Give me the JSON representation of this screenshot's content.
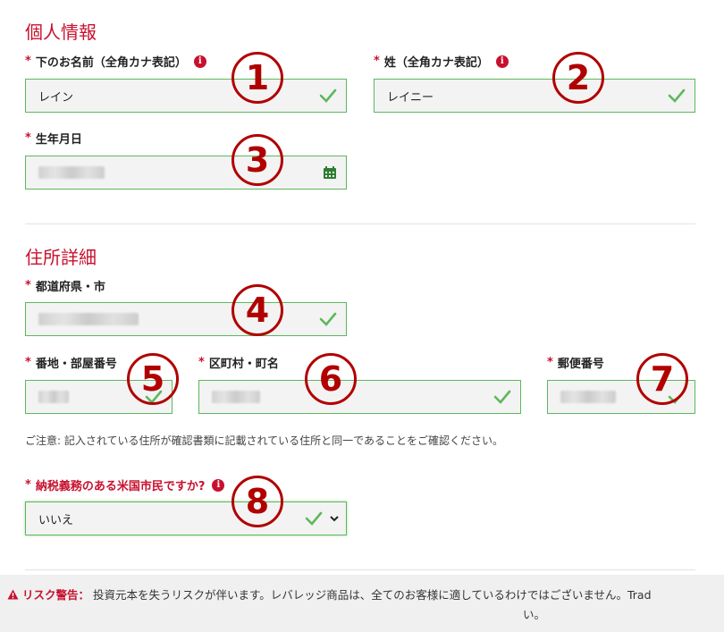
{
  "personal": {
    "section_title": "個人情報",
    "first_name_label": "下のお名前（全角カナ表記）",
    "first_name_value": "レイン",
    "last_name_label": "姓（全角カナ表記）",
    "last_name_value": "レイニー",
    "birthdate_label": "生年月日",
    "required_mark": "*",
    "info_glyph": "i"
  },
  "address": {
    "section_title": "住所詳細",
    "prefecture_label": "都道府県・市",
    "street_label": "番地・部屋番号",
    "ward_label": "区町村・町名",
    "postal_label": "郵便番号",
    "note": "ご注意: 記入されている住所が確認書類に記載されている住所と同一であることをご確認ください。"
  },
  "tax": {
    "question_label": "納税義務のある米国市民ですか?",
    "selected": "いいえ"
  },
  "annotations": [
    "1",
    "2",
    "3",
    "4",
    "5",
    "6",
    "7",
    "8"
  ],
  "risk": {
    "label": "リスク警告：",
    "text": "投資元本を失うリスクが伴います。レバレッジ商品は、全てのお客様に適しているわけではございません。Trad",
    "text_cont": "い。"
  },
  "colors": {
    "accent_red": "#c8102e",
    "valid_green": "#5cb85c",
    "annotation_red": "#b10000"
  },
  "icons": {
    "check": "check-icon",
    "calendar": "calendar-icon",
    "info": "info-icon",
    "warning": "warning-icon",
    "chevron": "chevron-down-icon"
  }
}
